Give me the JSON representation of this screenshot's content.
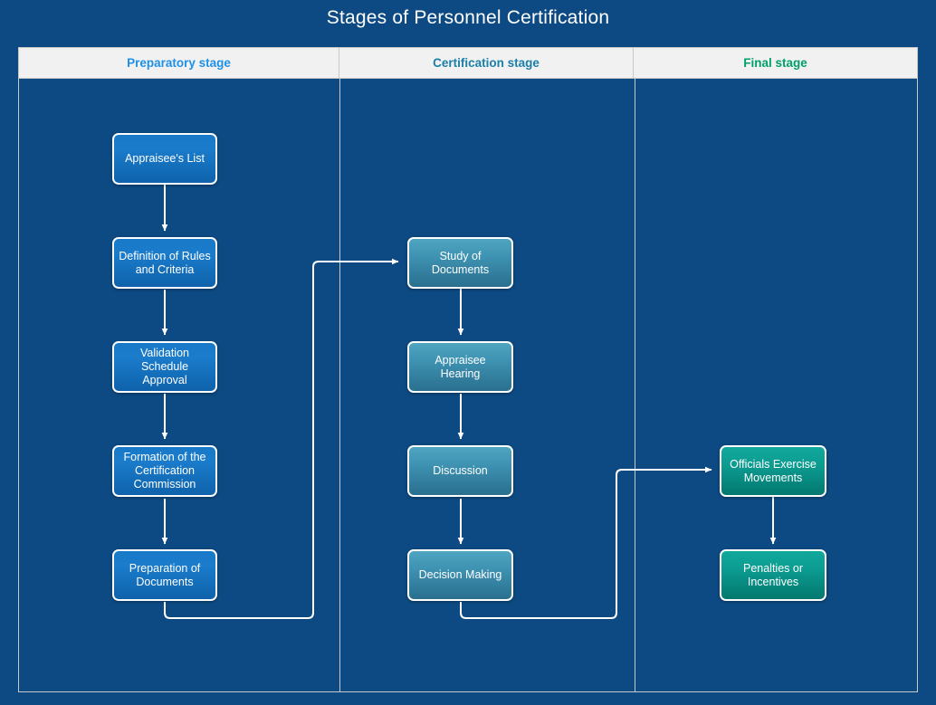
{
  "title": "Stages of Personnel Certification",
  "colors": {
    "background": "#0d4a83",
    "frame_border": "#c8c8c4",
    "header_band": "#f1f1f1",
    "header_preparatory": "#1e90e8",
    "header_certification": "#1a7fa8",
    "header_final": "#00a06a",
    "node_border": "#ffffff",
    "connector": "#ffffff",
    "title_text": "#ffffff"
  },
  "columns": [
    {
      "id": "preparatory",
      "label": "Preparatory stage"
    },
    {
      "id": "certification",
      "label": "Certification stage"
    },
    {
      "id": "final",
      "label": "Final stage"
    }
  ],
  "nodes": {
    "prep": [
      {
        "label": "Appraisee's List"
      },
      {
        "label": "Definition of Rules and Criteria"
      },
      {
        "label": "Validation Schedule Approval"
      },
      {
        "label": "Formation of the Certification Commission"
      },
      {
        "label": "Preparation of Documents"
      }
    ],
    "cert": [
      {
        "label": "Study of Documents"
      },
      {
        "label": "Appraisee Hearing"
      },
      {
        "label": "Discussion"
      },
      {
        "label": "Decision Making"
      }
    ],
    "final": [
      {
        "label": "Officials Exercise Movements"
      },
      {
        "label": "Penalties or Incentives"
      }
    ]
  },
  "flow": {
    "edges": [
      "Appraisee's List -> Definition of Rules and Criteria",
      "Definition of Rules and Criteria -> Validation Schedule Approval",
      "Validation Schedule Approval -> Formation of the Certification Commission",
      "Formation of the Certification Commission -> Preparation of Documents",
      "Preparation of Documents -> Study of Documents",
      "Study of Documents -> Appraisee Hearing",
      "Appraisee Hearing -> Discussion",
      "Discussion -> Decision Making",
      "Decision Making -> Officials Exercise Movements",
      "Officials Exercise Movements -> Penalties or Incentives"
    ]
  }
}
